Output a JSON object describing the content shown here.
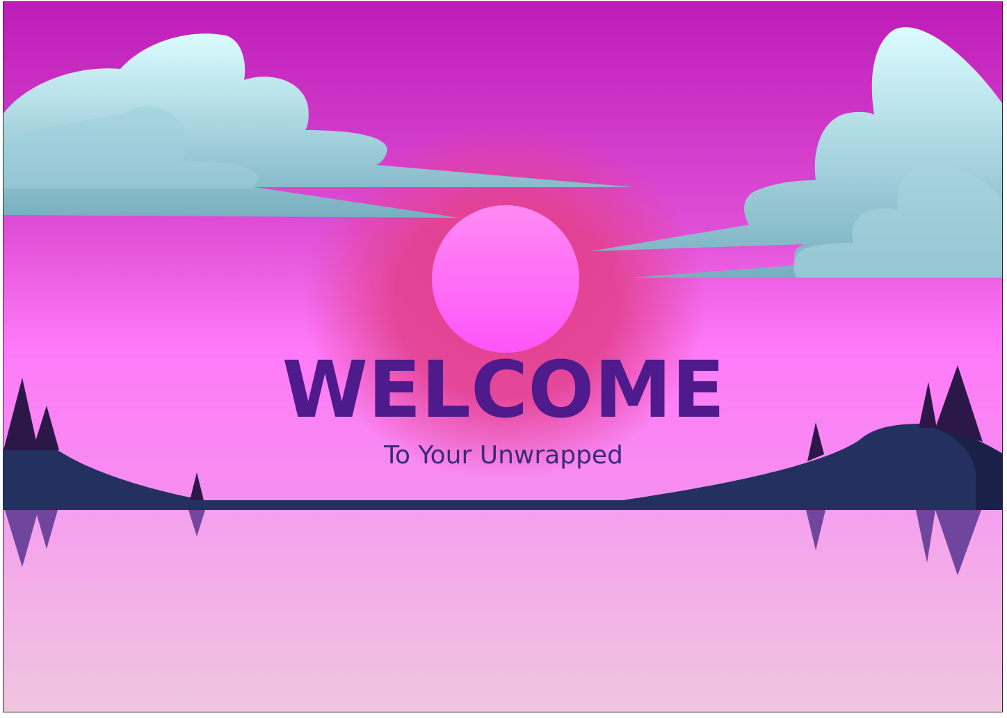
{
  "hero": {
    "title": "WELCOME",
    "subtitle": "To Your Unwrapped"
  },
  "colors": {
    "sky_top": "#bf1db8",
    "sky_mid": "#e34fd8",
    "sky_bottom": "#ff7cf7",
    "sun": "#ff61f5",
    "sun_glow": "#e3418f",
    "cloud_top": "#d5f8fc",
    "cloud_bottom": "#7fb3c4",
    "hill": "#253060",
    "tree": "#2c1848",
    "reflection": "#5a3590",
    "water_top": "#f6a0ef",
    "water_bottom": "#efc4e0",
    "title_text": "#4e1a8c",
    "subtitle_text": "#3a2b78"
  }
}
